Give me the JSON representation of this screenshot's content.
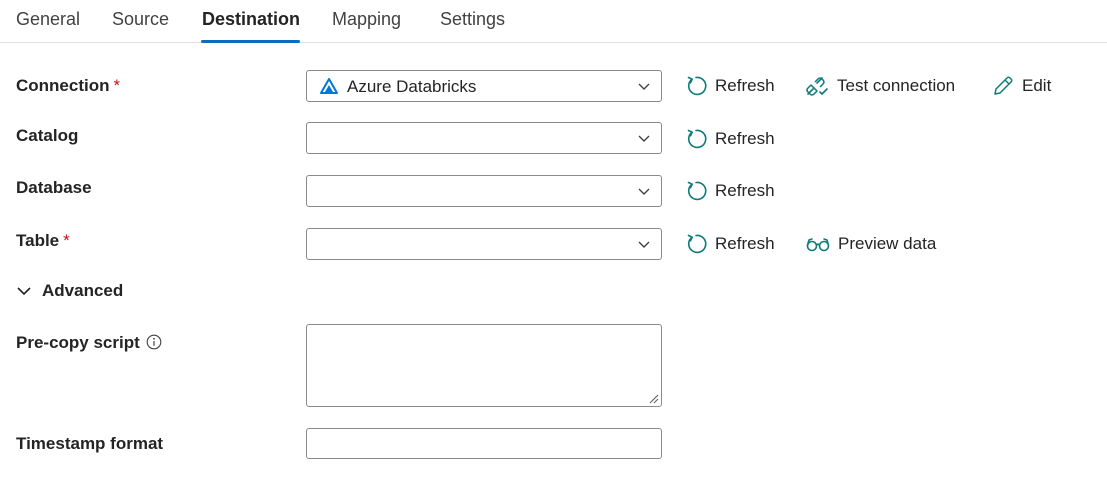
{
  "tabs": [
    {
      "label": "General",
      "active": false
    },
    {
      "label": "Source",
      "active": false
    },
    {
      "label": "Destination",
      "active": true
    },
    {
      "label": "Mapping",
      "active": false
    },
    {
      "label": "Settings",
      "active": false
    }
  ],
  "colors": {
    "accent": "#0f6cbd",
    "required": "#c50f1f",
    "icon_green": "#0e7a7a",
    "border": "#8a8a8a"
  },
  "form": {
    "connection": {
      "label": "Connection",
      "required_marker": "*",
      "value": "Azure Databricks",
      "icon": "azure-databricks-icon",
      "refresh_label": "Refresh",
      "test_label": "Test connection",
      "edit_label": "Edit"
    },
    "catalog": {
      "label": "Catalog",
      "value": "",
      "refresh_label": "Refresh"
    },
    "database": {
      "label": "Database",
      "value": "",
      "refresh_label": "Refresh"
    },
    "table": {
      "label": "Table",
      "required_marker": "*",
      "value": "",
      "refresh_label": "Refresh",
      "preview_label": "Preview data"
    },
    "advanced": {
      "label": "Advanced",
      "expanded": true
    },
    "pre_copy_script": {
      "label": "Pre-copy script",
      "value": ""
    },
    "timestamp_format": {
      "label": "Timestamp format",
      "value": ""
    }
  }
}
